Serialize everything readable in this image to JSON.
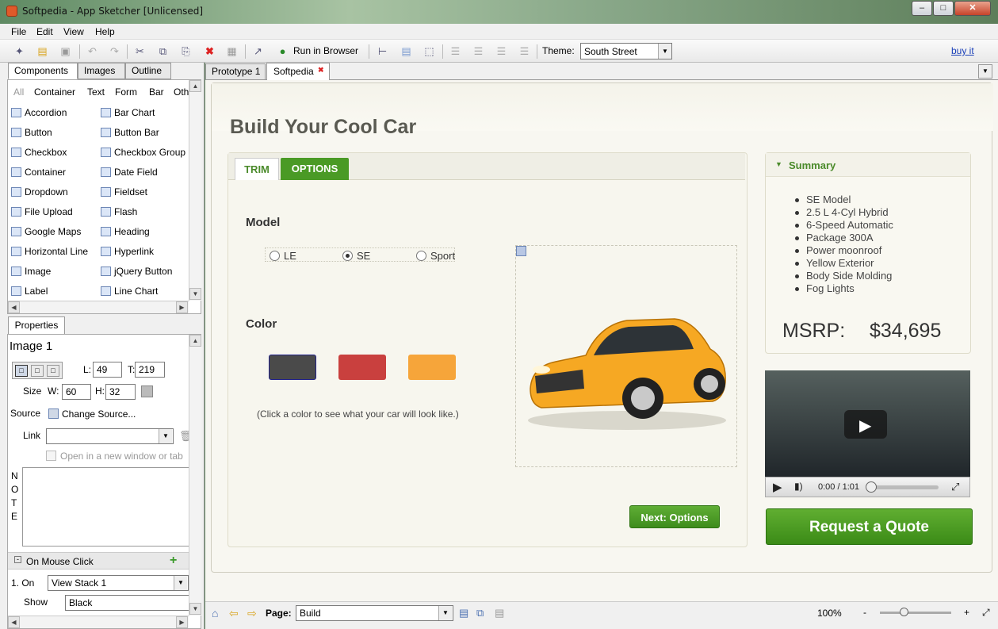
{
  "window": {
    "title": "Softpedia - App Sketcher [Unlicensed]"
  },
  "menu": [
    "File",
    "Edit",
    "View",
    "Help"
  ],
  "toolbar": {
    "run_label": "Run in Browser",
    "theme_label": "Theme:",
    "theme_value": "South Street",
    "buy_label": "buy it"
  },
  "left": {
    "tabs": [
      "Components",
      "Images",
      "Outline"
    ],
    "categories": [
      "All",
      "Container",
      "Text",
      "Form",
      "Bar",
      "Oth"
    ],
    "components_col1": [
      "Accordion",
      "Button",
      "Checkbox",
      "Container",
      "Dropdown",
      "File Upload",
      "Google Maps",
      "Horizontal Line",
      "Image",
      "Label"
    ],
    "components_col2": [
      "Bar Chart",
      "Button Bar",
      "Checkbox Group",
      "Date Field",
      "Fieldset",
      "Flash",
      "Heading",
      "Hyperlink",
      "jQuery Button",
      "Line Chart"
    ]
  },
  "properties": {
    "tab": "Properties",
    "title": "Image 1",
    "l_label": "L:",
    "l_value": "49",
    "t_label": "T:",
    "t_value": "219",
    "size_label": "Size",
    "w_label": "W:",
    "w_value": "60",
    "h_label": "H:",
    "h_value": "32",
    "source_label": "Source",
    "source_action": "Change Source...",
    "link_label": "Link",
    "newwin_label": "Open in a new window or tab",
    "note_label": "NOTE",
    "mouse_click_label": "On Mouse Click",
    "on_label": "1. On",
    "on_value": "View Stack 1",
    "show_label": "Show",
    "show_value": "Black"
  },
  "doc_tabs": [
    "Prototype 1",
    "Softpedia"
  ],
  "page": {
    "title": "Build Your Cool Car",
    "tabs": [
      "TRIM",
      "OPTIONS"
    ],
    "model_heading": "Model",
    "models": [
      "LE",
      "SE",
      "Sport"
    ],
    "selected_model": "SE",
    "color_heading": "Color",
    "swatch_colors": [
      "#4a4a4a",
      "#c9403e",
      "#f6a53a"
    ],
    "color_hint": "(Click a color to see what your car will look like.)",
    "next_button": "Next: Options",
    "summary_title": "Summary",
    "summary_items": [
      "SE Model",
      "2.5 L 4-Cyl Hybrid",
      "6-Speed Automatic",
      "Package 300A",
      "Power moonroof",
      "Yellow Exterior",
      "Body Side Molding",
      "Fog Lights"
    ],
    "msrp_label": "MSRP:",
    "msrp_value": "$34,695",
    "video_time": "0:00 / 1:01",
    "quote_button": "Request a Quote",
    "accent": "#4a9a25"
  },
  "bottom": {
    "page_label": "Page:",
    "page_value": "Build",
    "zoom": "100%",
    "minus": "-",
    "plus": "+"
  }
}
